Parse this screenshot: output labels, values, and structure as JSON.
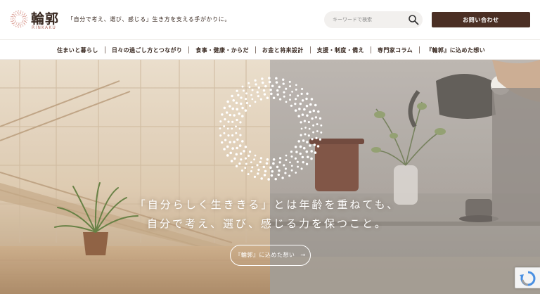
{
  "brand": {
    "name": "輪郭",
    "roman": "RINKAKU",
    "tagline": "「自分で考え、選び、感じる」生き方を支える手がかりに。",
    "accent_color": "#c98b80"
  },
  "search": {
    "placeholder": "キーワードで検索",
    "icon": "search-icon"
  },
  "header": {
    "contact_label": "お問い合わせ",
    "contact_color": "#4b2f24"
  },
  "nav": {
    "items": [
      {
        "label": "住まいと暮らし"
      },
      {
        "label": "日々の過ごし方とつながり"
      },
      {
        "label": "食事・健康・からだ"
      },
      {
        "label": "お金と将来設計"
      },
      {
        "label": "支援・制度・備え"
      },
      {
        "label": "専門家コラム"
      },
      {
        "label": "『輪郭』に込めた想い"
      }
    ]
  },
  "hero": {
    "line1": "「自分らしく生ききる」とは年齢を重ねても、",
    "line2": "自分で考え、選び、感じる力を保つこと。",
    "button_label": "『輪郭』に込めた想い",
    "button_arrow": "→"
  }
}
